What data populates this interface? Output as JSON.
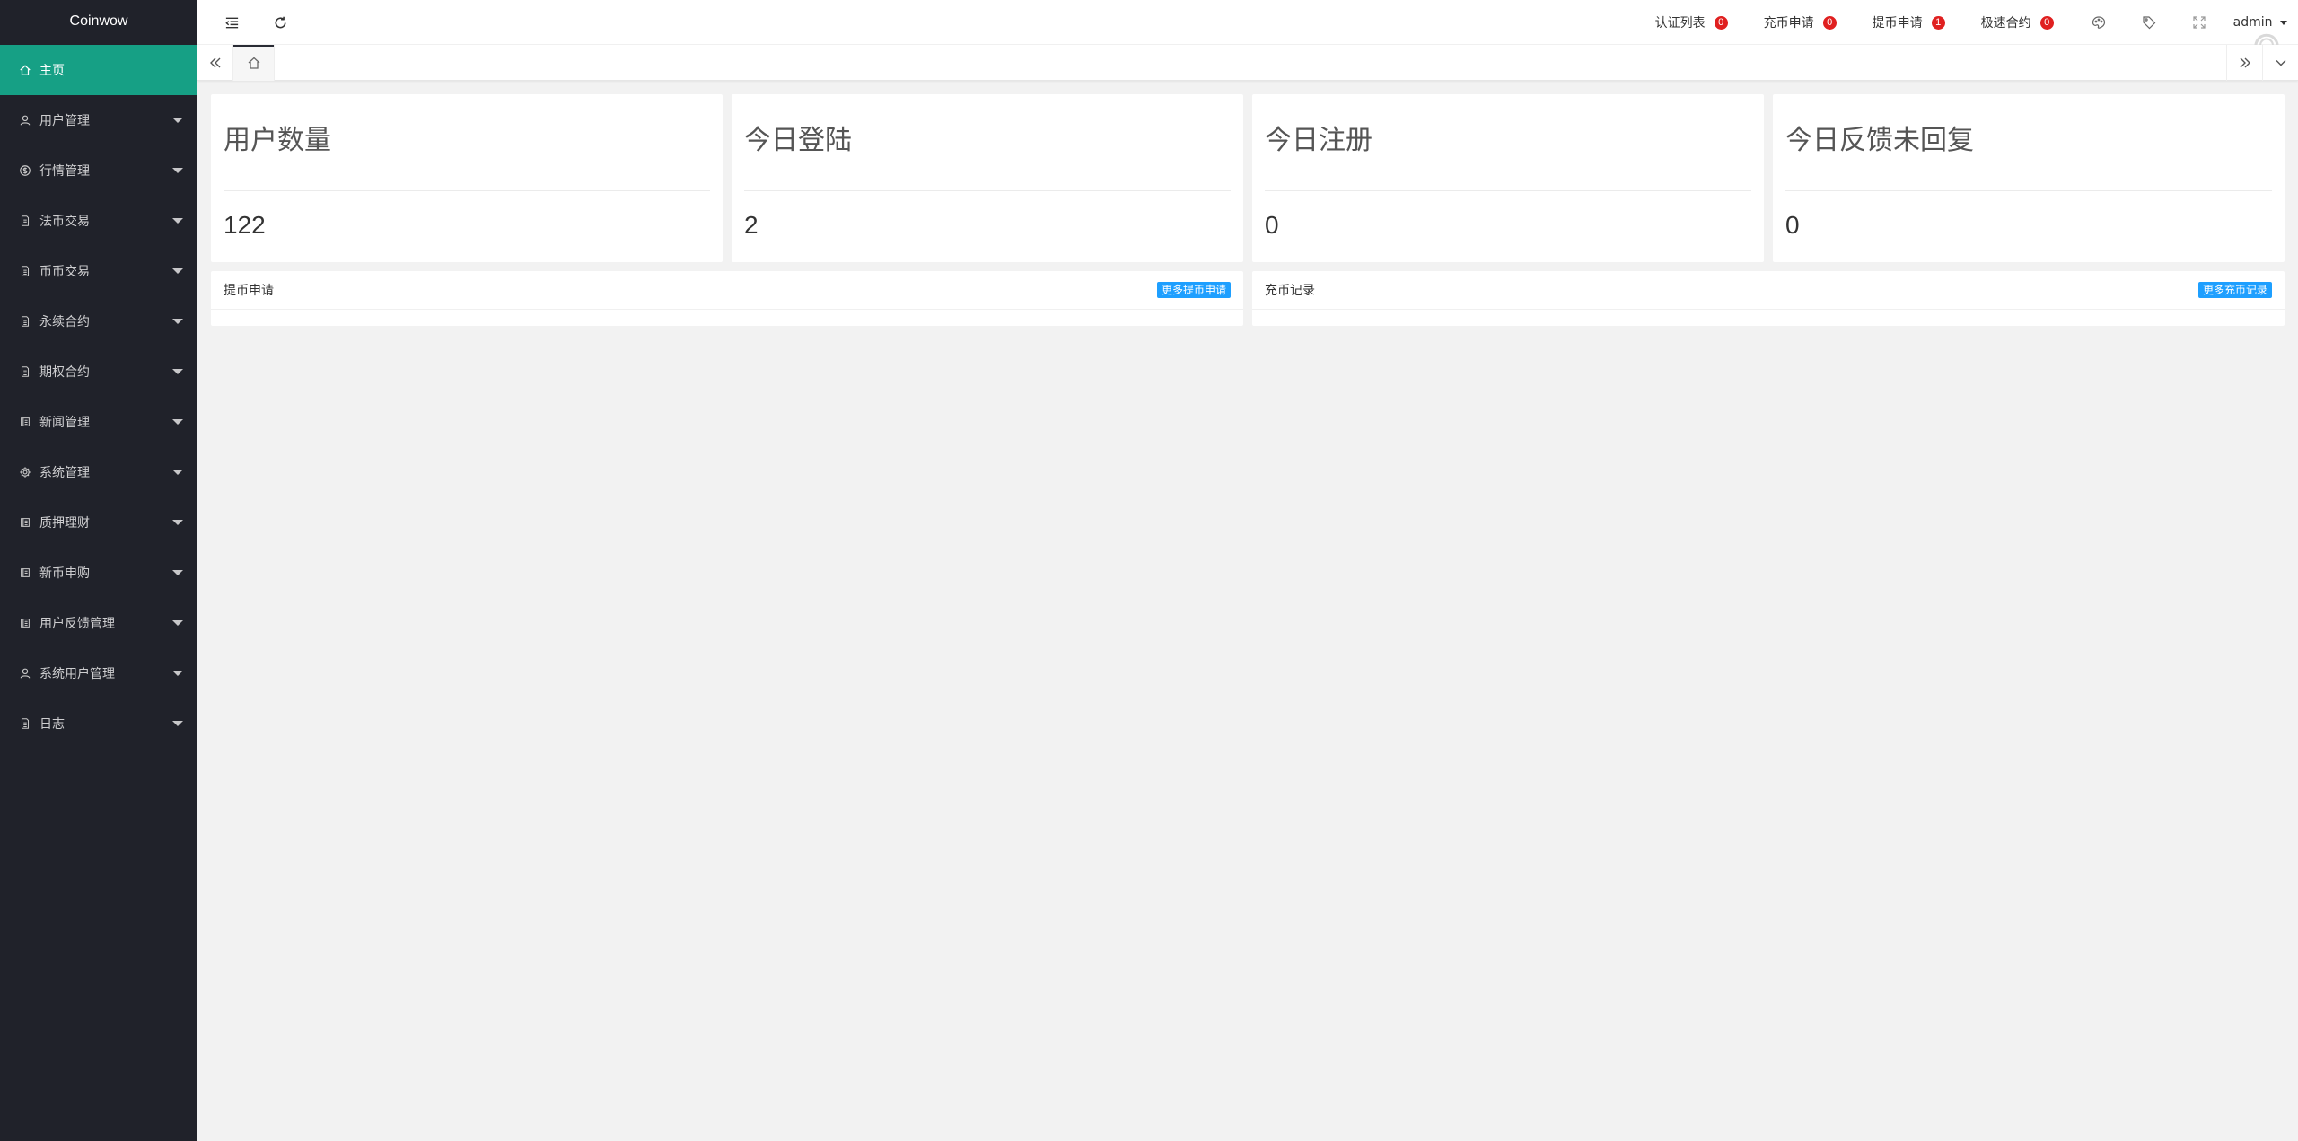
{
  "app": {
    "title": "Coinwow"
  },
  "sidebar": {
    "items": [
      {
        "label": "主页",
        "icon": "home-icon",
        "active": true
      },
      {
        "label": "用户管理",
        "icon": "user-icon"
      },
      {
        "label": "行情管理",
        "icon": "dollar-icon"
      },
      {
        "label": "法币交易",
        "icon": "doc-icon"
      },
      {
        "label": "币币交易",
        "icon": "doc-icon"
      },
      {
        "label": "永续合约",
        "icon": "doc-icon"
      },
      {
        "label": "期权合约",
        "icon": "doc-icon"
      },
      {
        "label": "新闻管理",
        "icon": "news-icon"
      },
      {
        "label": "系统管理",
        "icon": "gear-icon"
      },
      {
        "label": "质押理财",
        "icon": "news-icon"
      },
      {
        "label": "新币申购",
        "icon": "news-icon"
      },
      {
        "label": "用户反馈管理",
        "icon": "news-icon"
      },
      {
        "label": "系统用户管理",
        "icon": "user-icon"
      },
      {
        "label": "日志",
        "icon": "doc-icon"
      }
    ]
  },
  "header": {
    "links": [
      {
        "label": "认证列表",
        "count": "0"
      },
      {
        "label": "充币申请",
        "count": "0"
      },
      {
        "label": "提币申请",
        "count": "1"
      },
      {
        "label": "极速合约",
        "count": "0"
      }
    ],
    "user": "admin"
  },
  "stats": [
    {
      "title": "用户数量",
      "value": "122"
    },
    {
      "title": "今日登陆",
      "value": "2"
    },
    {
      "title": "今日注册",
      "value": "0"
    },
    {
      "title": "今日反馈未回复",
      "value": "0"
    }
  ],
  "panels": [
    {
      "title": "提币申请",
      "button": "更多提币申请"
    },
    {
      "title": "充币记录",
      "button": "更多充币记录"
    }
  ],
  "colors": {
    "sidebar_bg": "#20222a",
    "active_item": "#16a085",
    "badge": "#e02020",
    "button": "#1e9fff"
  }
}
